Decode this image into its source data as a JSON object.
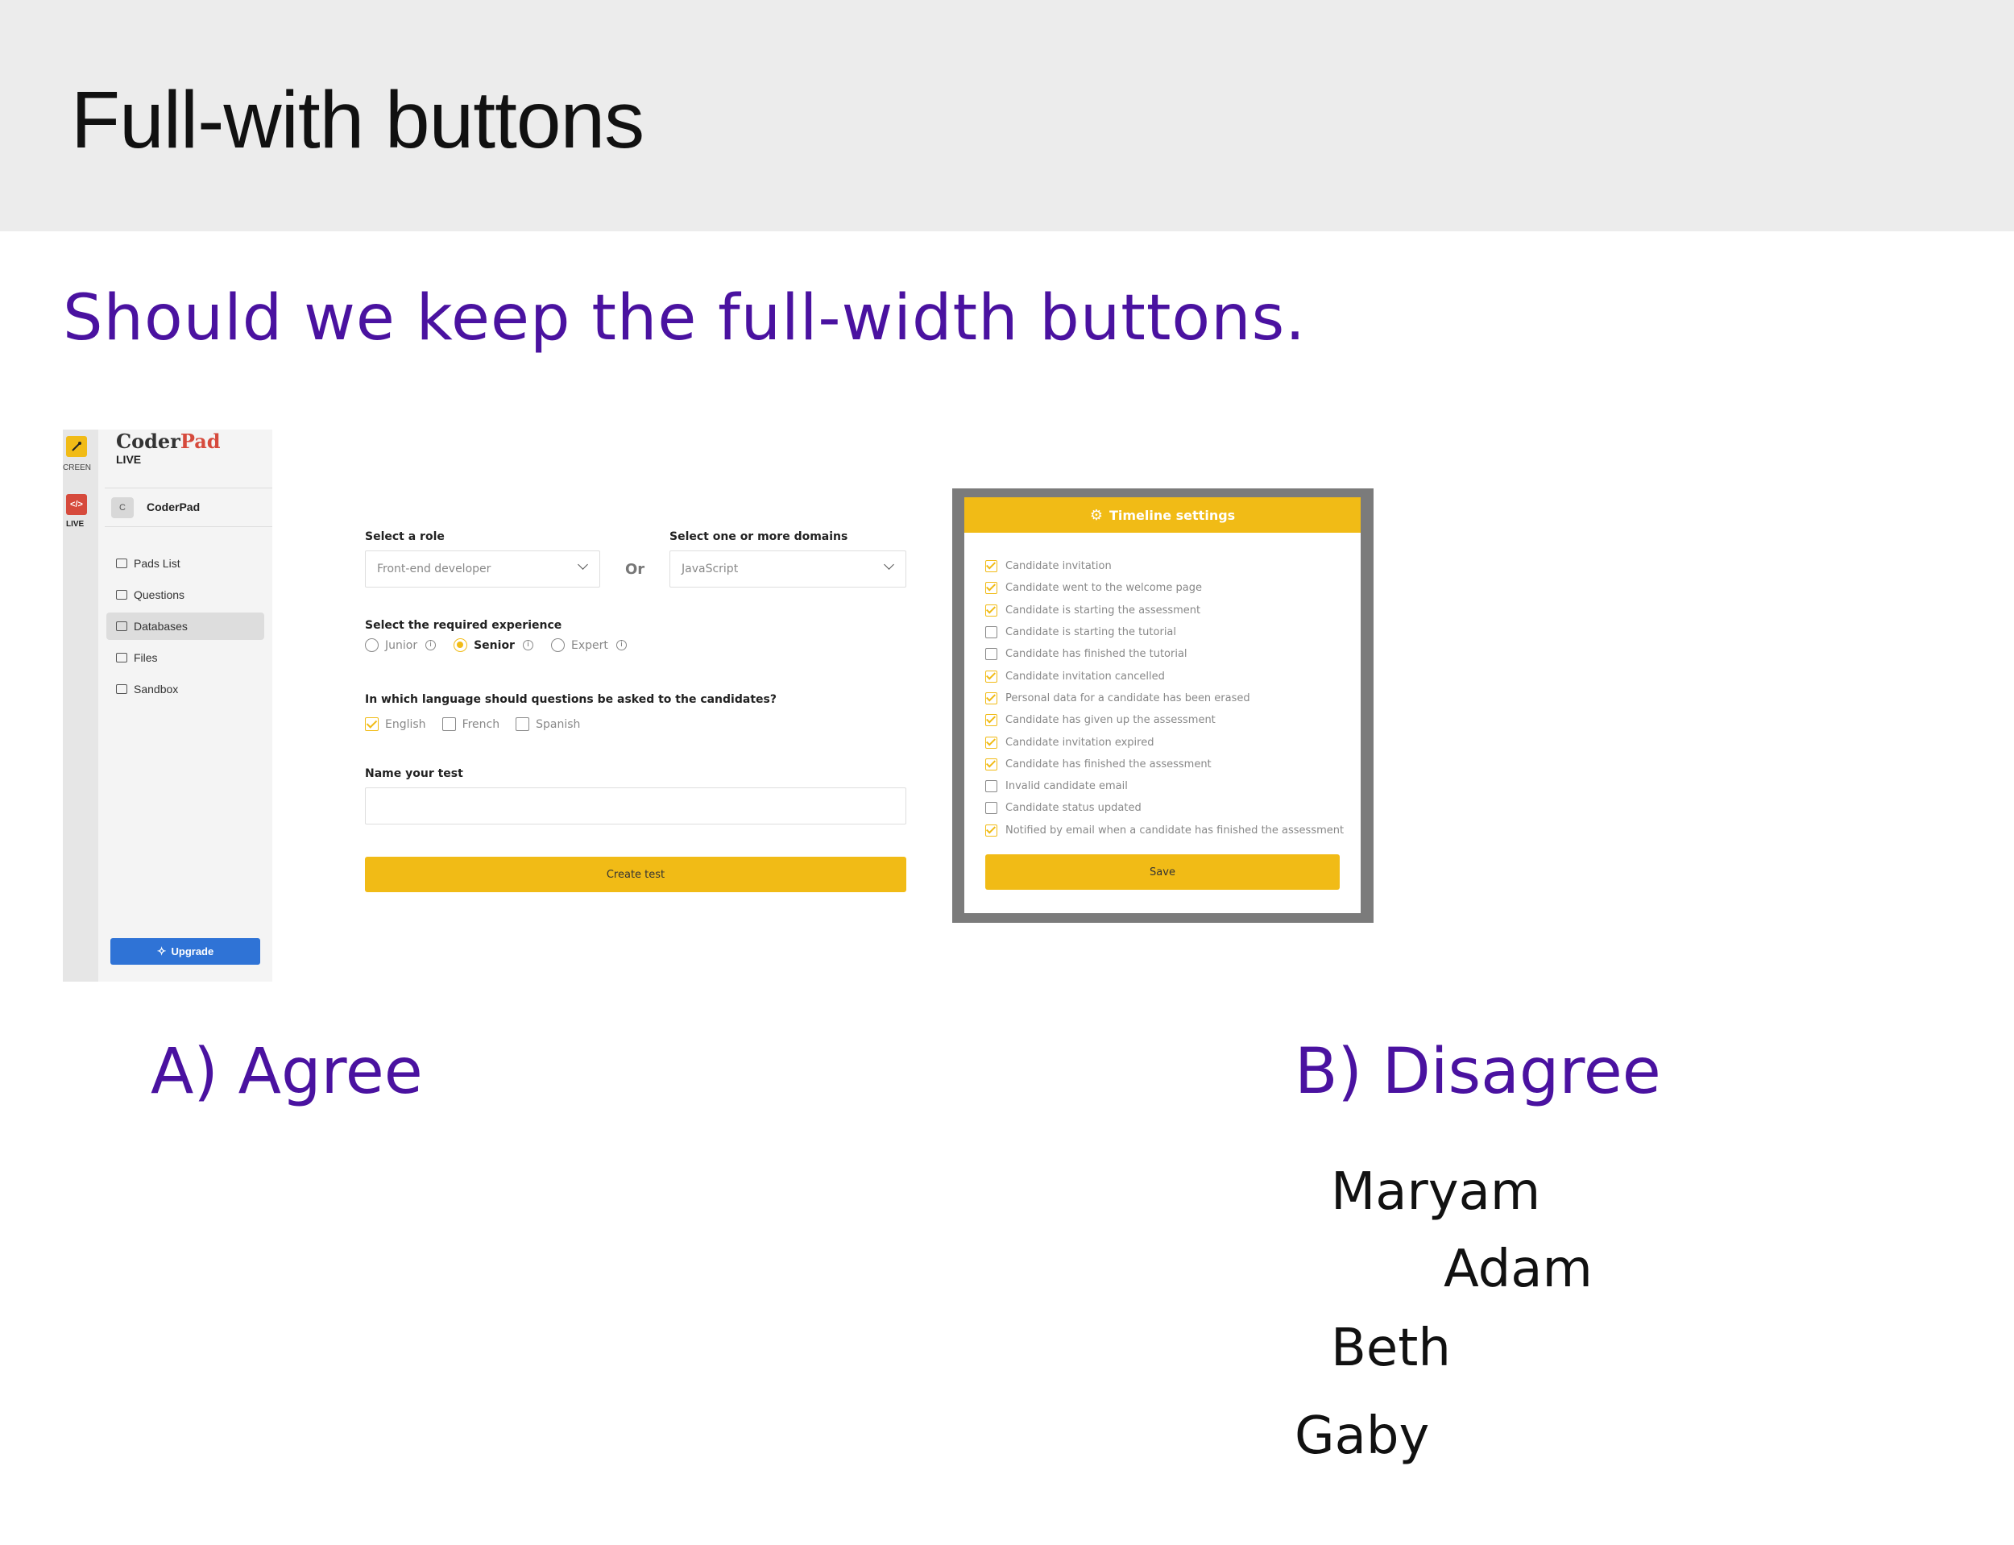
{
  "slide": {
    "title": "Full-with buttons",
    "question": "Should we keep the full-width buttons.",
    "accent_color": "#4a12a0"
  },
  "options": {
    "a_label": "A) Agree",
    "b_label": "B) Disagree"
  },
  "votes": {
    "b": [
      "Maryam",
      "Adam",
      "Beth",
      "Gaby"
    ]
  },
  "coderpad": {
    "rail_screen_label": "CREEN",
    "rail_live_label": "LIVE",
    "rail_live_icon": "</>",
    "logo_coder": "Coder",
    "logo_pad": "Pad",
    "logo_sub": "LIVE",
    "org_initial": "C",
    "org_name": "CoderPad",
    "nav": [
      {
        "label": "Pads List",
        "icon": "terminal-icon",
        "active": false
      },
      {
        "label": "Questions",
        "icon": "question-icon",
        "active": false
      },
      {
        "label": "Databases",
        "icon": "database-icon",
        "active": true
      },
      {
        "label": "Files",
        "icon": "folder-icon",
        "active": false
      },
      {
        "label": "Sandbox",
        "icon": "cube-icon",
        "active": false
      }
    ],
    "upgrade_label": "Upgrade",
    "brand_color": "#2f73d6"
  },
  "form": {
    "role_label": "Select a role",
    "role_value": "Front-end developer",
    "or_label": "Or",
    "domain_label": "Select one or more domains",
    "domain_value": "JavaScript",
    "experience_label": "Select the required experience",
    "experience_options": [
      "Junior",
      "Senior",
      "Expert"
    ],
    "experience_selected": "Senior",
    "language_label": "In which language should questions be asked to the candidates?",
    "languages": [
      {
        "label": "English",
        "checked": true
      },
      {
        "label": "French",
        "checked": false
      },
      {
        "label": "Spanish",
        "checked": false
      }
    ],
    "name_label": "Name your test",
    "name_value": "",
    "create_button": "Create test",
    "button_color": "#f1bb16"
  },
  "timeline": {
    "title": "Timeline settings",
    "items": [
      {
        "label": "Candidate invitation",
        "checked": true
      },
      {
        "label": "Candidate went to the welcome page",
        "checked": true
      },
      {
        "label": "Candidate is starting the assessment",
        "checked": true
      },
      {
        "label": "Candidate is starting the tutorial",
        "checked": false
      },
      {
        "label": "Candidate has finished the tutorial",
        "checked": false
      },
      {
        "label": "Candidate invitation cancelled",
        "checked": true
      },
      {
        "label": "Personal data for a candidate has been erased",
        "checked": true
      },
      {
        "label": "Candidate has given up the assessment",
        "checked": true
      },
      {
        "label": "Candidate invitation expired",
        "checked": true
      },
      {
        "label": "Candidate has finished the assessment",
        "checked": true
      },
      {
        "label": "Invalid candidate email",
        "checked": false
      },
      {
        "label": "Candidate status updated",
        "checked": false
      },
      {
        "label": "Notified by email when a candidate has finished the assessment",
        "checked": true
      }
    ],
    "save_button": "Save"
  }
}
